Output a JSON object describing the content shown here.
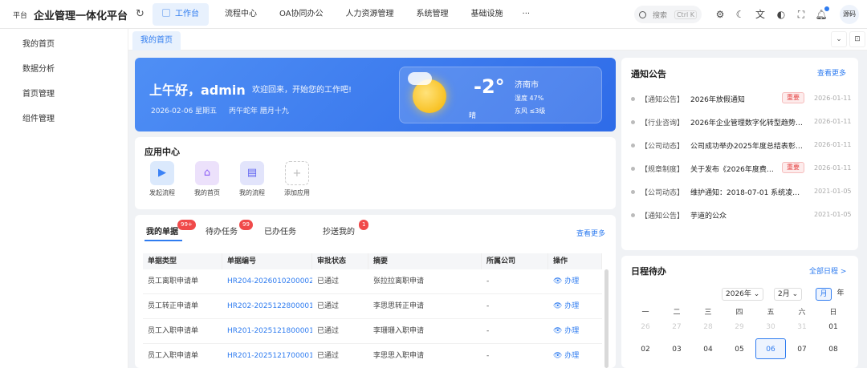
{
  "header": {
    "logo_small": "平台",
    "app_title": "企业管理一体化平台",
    "nav": [
      "工作台",
      "流程中心",
      "OA协同办公",
      "人力资源管理",
      "系统管理",
      "基础设施"
    ],
    "more": "···",
    "search_placeholder": "搜索",
    "search_shortcut": "Ctrl K",
    "avatar_text": "源码"
  },
  "sidebar": {
    "items": [
      "我的首页",
      "数据分析",
      "首页管理",
      "组件管理"
    ]
  },
  "tabs": {
    "active": "我的首页"
  },
  "banner": {
    "greeting": "上午好，admin",
    "subtitle": "欢迎回来，开始您的工作吧!",
    "date": "2026-02-06 星期五",
    "lunar": "丙午蛇年 腊月十九",
    "weather": {
      "temp": "-2°",
      "desc": "晴",
      "city": "济南市",
      "humidity": "湿度 47%",
      "wind": "东风 ≤3级"
    }
  },
  "apps": {
    "title": "应用中心",
    "items": [
      {
        "label": "发起流程",
        "icon": "play-icon",
        "color": "#dbe9fc",
        "fg": "#3b82f6"
      },
      {
        "label": "我的首页",
        "icon": "home-icon",
        "color": "#ece1fb",
        "fg": "#8b5cf6"
      },
      {
        "label": "我的流程",
        "icon": "document-icon",
        "color": "#e2e4fb",
        "fg": "#6366f1"
      },
      {
        "label": "添加应用",
        "icon": "plus-icon",
        "color": "#ffffff",
        "fg": "#bbbbbb"
      }
    ]
  },
  "tasks": {
    "tabs": [
      "我的单据",
      "待办任务",
      "已办任务",
      "抄送我的"
    ],
    "badges": [
      "99+",
      "99",
      "1"
    ],
    "more": "查看更多",
    "columns": [
      "单据类型",
      "单据编号",
      "审批状态",
      "摘要",
      "所属公司",
      "操作"
    ],
    "rows": [
      [
        "员工离职申请单",
        "HR204-2026010200002",
        "已通过",
        "张拉拉离职申请",
        "-",
        "办理"
      ],
      [
        "员工转正申请单",
        "HR202-2025122800001",
        "已通过",
        "李思思转正申请",
        "-",
        "办理"
      ],
      [
        "员工入职申请单",
        "HR201-2025121800001",
        "已通过",
        "李珊珊入职申请",
        "-",
        "办理"
      ],
      [
        "员工入职申请单",
        "HR201-2025121700001",
        "已通过",
        "李思思入职申请",
        "-",
        "办理"
      ]
    ]
  },
  "notice": {
    "title": "通知公告",
    "more": "查看更多",
    "items": [
      {
        "cat": "【通知公告】",
        "text": "2026年放假通知",
        "tag": "重要",
        "date": "2026-01-11"
      },
      {
        "cat": "【行业咨询】",
        "text": "2026年企业管理数字化转型趋势…",
        "tag": "",
        "date": "2026-01-11"
      },
      {
        "cat": "【公司动态】",
        "text": "公司成功举办2025年度总结表彰…",
        "tag": "",
        "date": "2026-01-11"
      },
      {
        "cat": "【规章制度】",
        "text": "关于发布《2026年度费…",
        "tag": "重要",
        "date": "2026-01-11"
      },
      {
        "cat": "【公司动态】",
        "text": "维护通知：2018-07-01 系统凌…",
        "tag": "",
        "date": "2021-01-05"
      },
      {
        "cat": "【通知公告】",
        "text": "芋道的公众",
        "tag": "",
        "date": "2021-01-05"
      }
    ]
  },
  "schedule": {
    "title": "日程待办",
    "all_link": "全部日程 >",
    "year": "2026年",
    "month": "2月",
    "view_month": "月",
    "view_year": "年",
    "weekdays": [
      "一",
      "二",
      "三",
      "四",
      "五",
      "六",
      "日"
    ],
    "week1": [
      "26",
      "27",
      "28",
      "29",
      "30",
      "31",
      "01"
    ],
    "week2": [
      "02",
      "03",
      "04",
      "05",
      "06",
      "07",
      "08"
    ]
  }
}
